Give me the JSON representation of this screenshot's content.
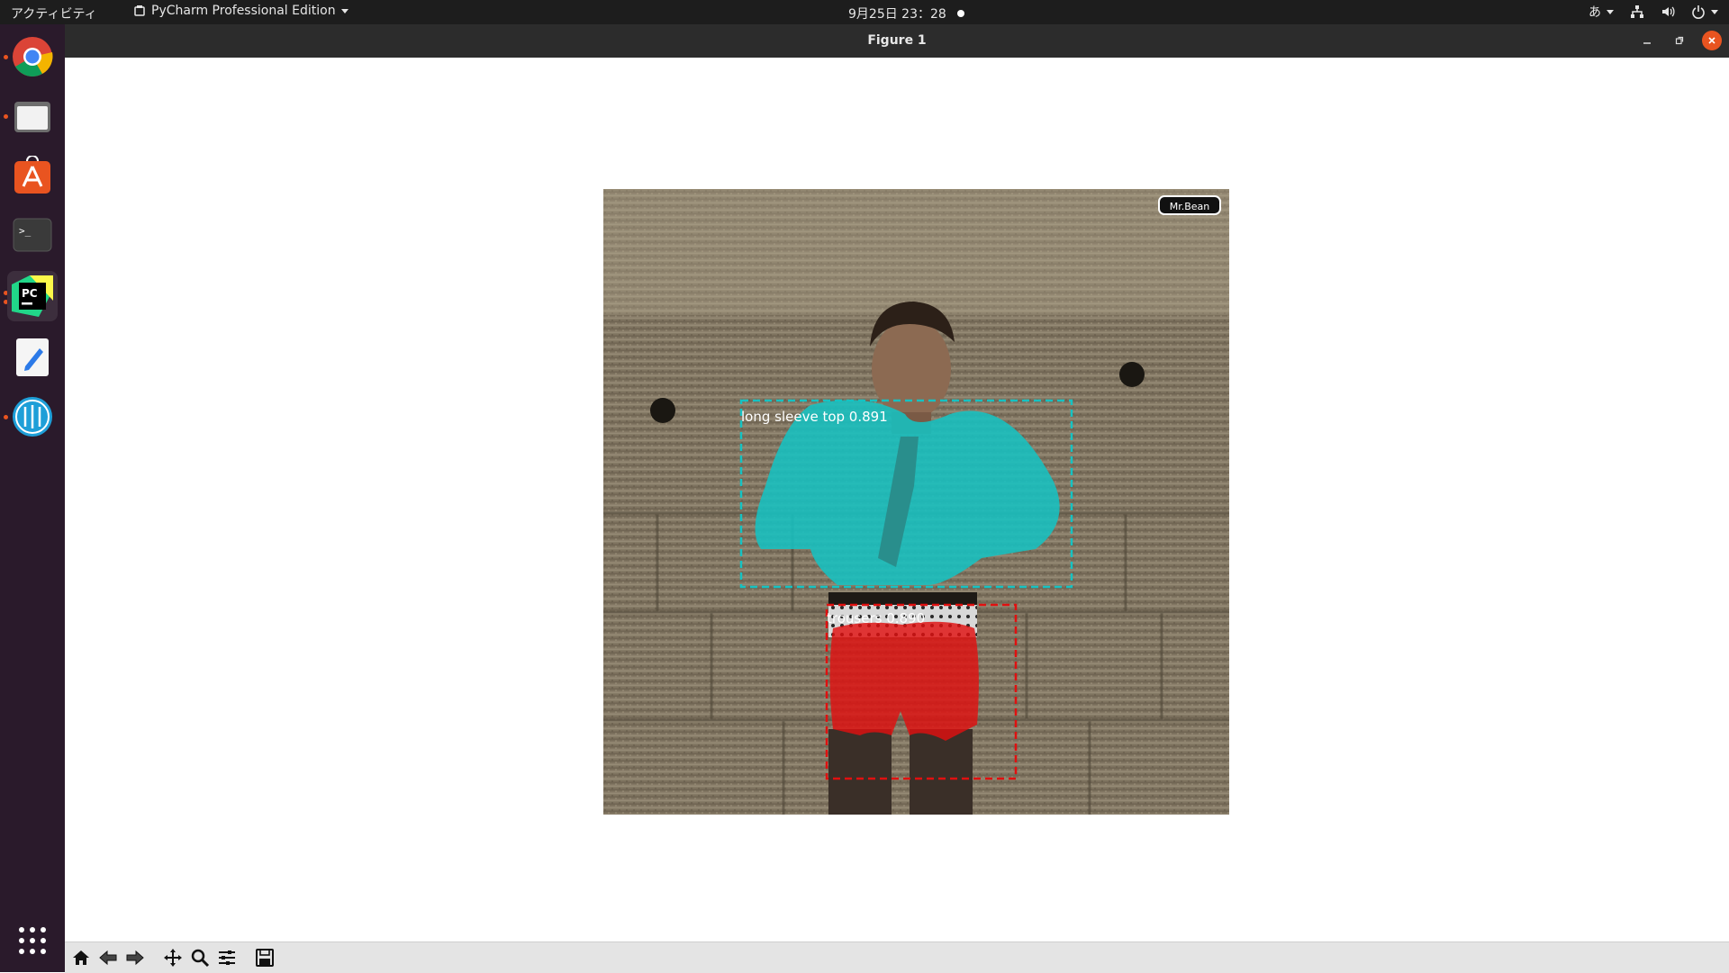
{
  "topbar": {
    "activities": "アクティビティ",
    "app_menu": "PyCharm Professional Edition",
    "clock": "9月25日  23：28",
    "ime": "あ"
  },
  "dock": {
    "items": [
      {
        "name": "chrome-icon",
        "running": true
      },
      {
        "name": "files-icon",
        "running": true
      },
      {
        "name": "software-center-icon",
        "running": false
      },
      {
        "name": "terminal-icon",
        "running": false
      },
      {
        "name": "pycharm-icon",
        "running": true
      },
      {
        "name": "text-editor-icon",
        "running": false
      },
      {
        "name": "pycharm-clone-icon",
        "running": true
      }
    ],
    "show_apps_icon": "grid-icon"
  },
  "window": {
    "title": "Figure 1"
  },
  "figure": {
    "detections": [
      {
        "label": "long sleeve top 0.891",
        "color": "#16c2c2"
      },
      {
        "label": "trousers 0.890",
        "color": "#e01010"
      }
    ],
    "watermark": "Mr.Bean"
  },
  "toolbar": {
    "buttons": [
      "home-icon",
      "back-icon",
      "forward-icon",
      "pan-icon",
      "zoom-icon",
      "configure-subplots-icon",
      "save-icon"
    ]
  },
  "colors": {
    "topbar_bg": "#1d1d1d",
    "dock_bg": "#2a1a2b",
    "titlebar_bg": "#2c2c2c",
    "accent_orange": "#e95420",
    "toolbar_bg": "#e4e4e4"
  }
}
